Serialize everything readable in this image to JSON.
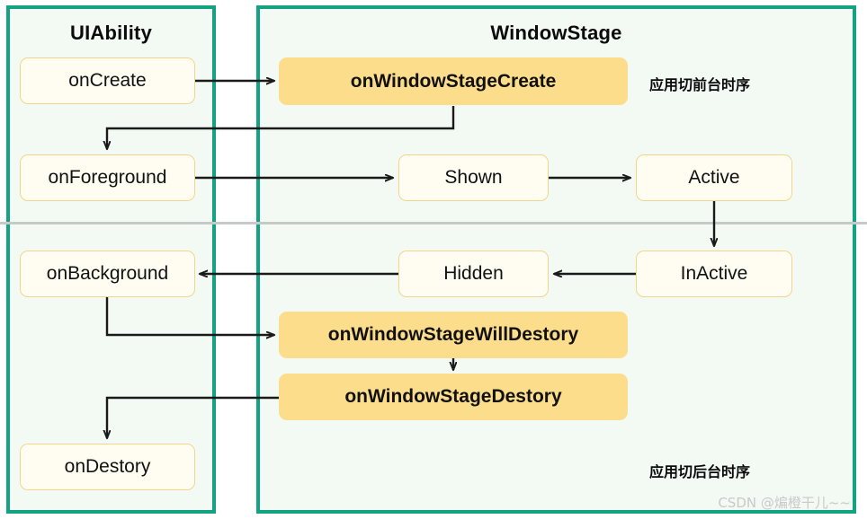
{
  "diagram": {
    "title_left": "UIAbility",
    "title_right": "WindowStage",
    "annotation_foreground": "应用切前台时序",
    "annotation_background": "应用切后台时序",
    "watermark": "CSDN @煸橙干儿~~",
    "colors": {
      "panel_border": "#13a383",
      "panel_fill": "#f2faf3",
      "node_plain_fill": "#fffdf2",
      "node_plain_border": "#f2d58a",
      "node_highlight_fill": "#fcdd8c",
      "arrow": "#1a1a1a",
      "divider": "#c5c9c7",
      "watermark": "#c9c9c9"
    }
  },
  "nodes": {
    "on_create": "onCreate",
    "on_foreground": "onForeground",
    "on_background": "onBackground",
    "on_destory": "onDestory",
    "on_window_stage_create": "onWindowStageCreate",
    "shown": "Shown",
    "active": "Active",
    "inactive": "InActive",
    "hidden": "Hidden",
    "on_window_stage_will_destory": "onWindowStageWillDestory",
    "on_window_stage_destory": "onWindowStageDestory"
  },
  "flows": [
    {
      "from": "onCreate",
      "to": "onWindowStageCreate"
    },
    {
      "from": "onWindowStageCreate",
      "to": "onForeground"
    },
    {
      "from": "onForeground",
      "to": "Shown"
    },
    {
      "from": "Shown",
      "to": "Active"
    },
    {
      "from": "Active",
      "to": "InActive"
    },
    {
      "from": "InActive",
      "to": "Hidden"
    },
    {
      "from": "Hidden",
      "to": "onBackground"
    },
    {
      "from": "onBackground",
      "to": "onWindowStageWillDestory"
    },
    {
      "from": "onWindowStageWillDestory",
      "to": "onWindowStageDestory"
    },
    {
      "from": "onWindowStageDestory",
      "to": "onDestory"
    }
  ]
}
